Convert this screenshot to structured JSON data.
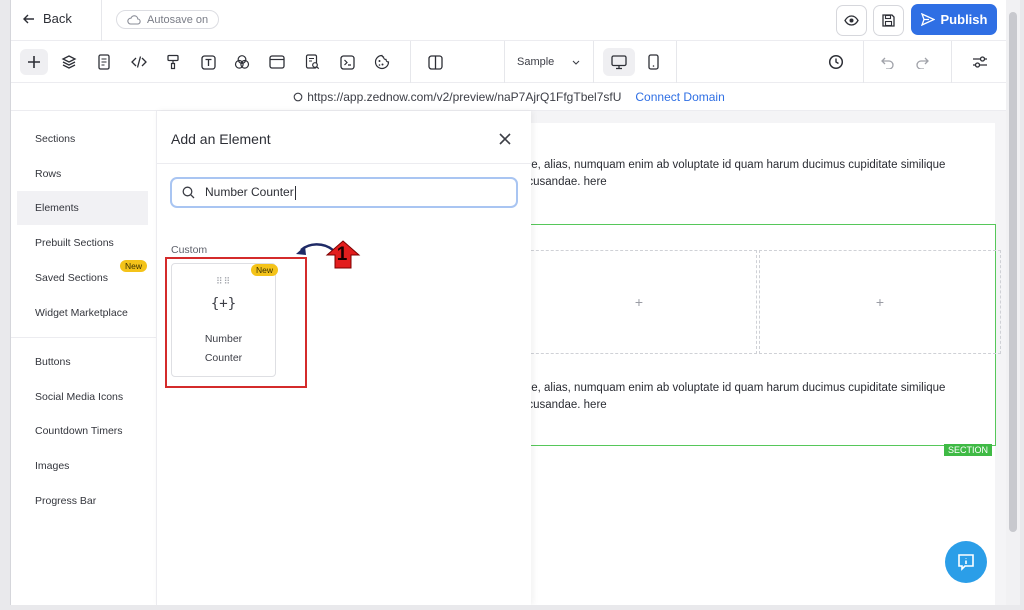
{
  "topbar": {
    "back_label": "Back",
    "autosave_label": "Autosave on",
    "publish_label": "Publish"
  },
  "toolbar": {
    "device_select": "Sample"
  },
  "urlbar": {
    "url": "https://app.zednow.com/v2/preview/naP7AjrQ1FfgTbel7sfU",
    "connect_label": "Connect Domain"
  },
  "sidebar": {
    "items": [
      {
        "label": "Sections"
      },
      {
        "label": "Rows"
      },
      {
        "label": "Elements"
      },
      {
        "label": "Prebuilt Sections"
      },
      {
        "label": "Saved Sections",
        "badge": "New"
      },
      {
        "label": "Widget Marketplace"
      },
      {
        "label": "Buttons"
      },
      {
        "label": "Social Media Icons"
      },
      {
        "label": "Countdown Timers"
      },
      {
        "label": "Images"
      },
      {
        "label": "Progress Bar"
      }
    ]
  },
  "panel": {
    "title": "Add an Element",
    "search_value": "Number Counter",
    "group_label": "Custom",
    "card": {
      "badge": "New",
      "icon": "{+}",
      "label_line1": "Number",
      "label_line2": "Counter"
    },
    "annotation_number": "1"
  },
  "canvas": {
    "paragraph_line1": "ore, alias, numquam enim ab voluptate id quam harum ducimus cupiditate similique",
    "paragraph_line2": "ecusandae. here",
    "paragraph2_line1": "ore, alias, numquam enim ab voluptate id quam harum ducimus cupiditate similique",
    "paragraph2_line2": "ecusandae. here",
    "cell_plus": "+",
    "section_tag": "SECTION"
  },
  "colors": {
    "accent": "#2f6fe4",
    "section_green": "#3fba45",
    "highlight_red": "#d42b2b",
    "badge_yellow": "#f4c319"
  }
}
